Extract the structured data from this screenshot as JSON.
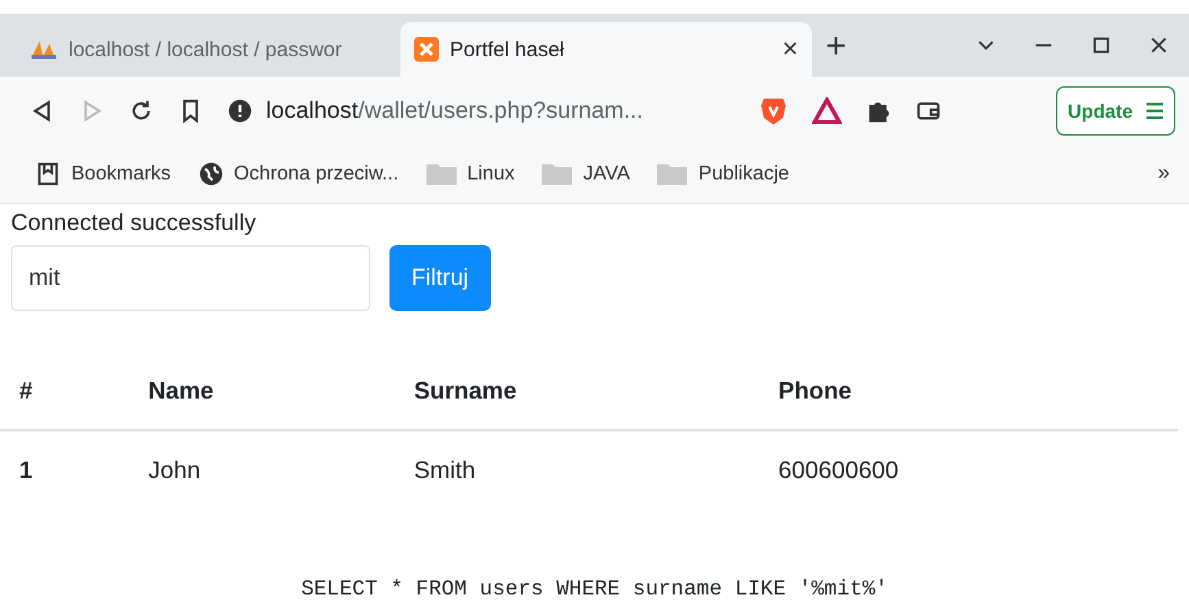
{
  "browser": {
    "tabs": [
      {
        "title": "localhost / localhost / passwor",
        "selected": false,
        "kind": "pma"
      },
      {
        "title": "Portfel haseł",
        "selected": true,
        "kind": "xampp"
      }
    ],
    "close_tab": "×",
    "new_tab": "+",
    "address": {
      "host": "localhost",
      "path": "/wallet/users.php?surnam..."
    },
    "update": "Update",
    "bookmarks": [
      {
        "label": "Bookmarks",
        "kind": "bookmark"
      },
      {
        "label": "Ochrona przeciw...",
        "kind": "globe"
      },
      {
        "label": "Linux",
        "kind": "folder"
      },
      {
        "label": "JAVA",
        "kind": "folder"
      },
      {
        "label": "Publikacje",
        "kind": "folder"
      }
    ],
    "more": "»"
  },
  "page": {
    "status": "Connected successfully",
    "filter": {
      "value": "mit"
    },
    "button": "Filtruj",
    "table": {
      "columns": [
        "#",
        "Name",
        "Surname",
        "Phone"
      ],
      "rows": [
        [
          "1",
          "John",
          "Smith",
          "600600600"
        ]
      ]
    },
    "query": "SELECT * FROM users WHERE surname LIKE '%mit%'"
  }
}
